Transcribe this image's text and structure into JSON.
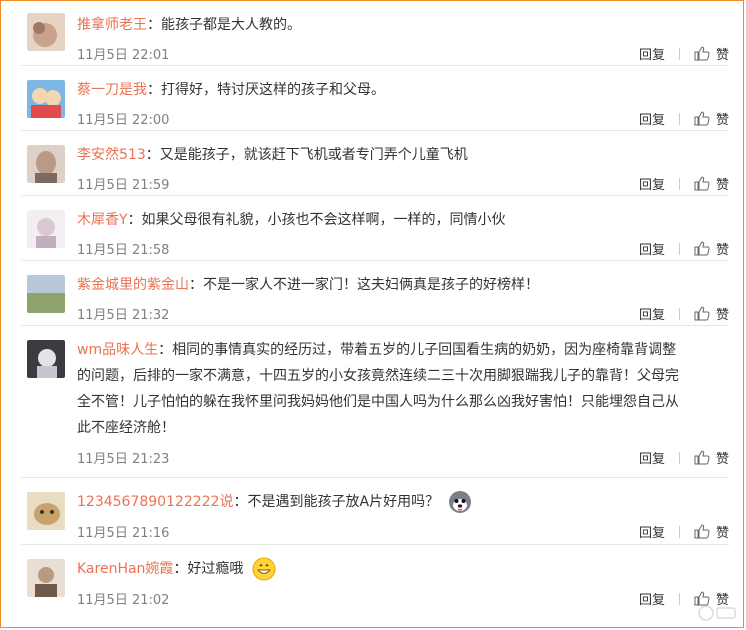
{
  "actions": {
    "reply_label": "回复",
    "like_label": "赞"
  },
  "comments": [
    {
      "user": "推拿师老王",
      "text": "：能孩子都是大人教的。",
      "time": "11月5日 22:01",
      "avatar_color": "#c9a28b"
    },
    {
      "user": "蔡一刀是我",
      "text": "：打得好，特讨厌这样的孩子和父母。",
      "time": "11月5日 22:00",
      "avatar_color": "#7cb7e6"
    },
    {
      "user": "李安然513",
      "text": "：又是能孩子，就该赶下飞机或者专门弄个儿童飞机",
      "time": "11月5日 21:59",
      "avatar_color": "#b89a86"
    },
    {
      "user": "木犀香Y",
      "text": "：如果父母很有礼貌，小孩也不会这样啊，一样的，同情小伙",
      "time": "11月5日 21:58",
      "avatar_color": "#d9c9d2"
    },
    {
      "user": "紫金城里的紫金山",
      "text": "：不是一家人不进一家门！这夫妇俩真是孩子的好榜样！",
      "time": "11月5日 21:32",
      "avatar_color": "#8fa36f"
    },
    {
      "user": "wm品味人生",
      "text_lines": [
        "：相同的事情真实的经历过，带着五岁的儿子回国看生病的奶奶，因为座椅靠背调整",
        "的问题，后排的一家不满意，十四五岁的小女孩竟然连续二三十次用脚狠踹我儿子的靠背！父母完",
        "全不管！儿子怕怕的躲在我怀里问我妈妈他们是中国人吗为什么那么凶我好害怕！只能埋怨自己从",
        "此不座经济舱！"
      ],
      "time": "11月5日 21:23",
      "avatar_color": "#6e6a73"
    },
    {
      "user": "1234567890122222说",
      "text": "：不是遇到能孩子放A片好用吗？",
      "time": "11月5日 21:16",
      "avatar_color": "#c7a36a",
      "emoji": "husky-face-emoji"
    },
    {
      "user": "KarenHan婉霞",
      "text": "：好过瘾哦",
      "time": "11月5日 21:02",
      "avatar_color": "#b79a80",
      "emoji": "grinning-face-emoji"
    }
  ]
}
